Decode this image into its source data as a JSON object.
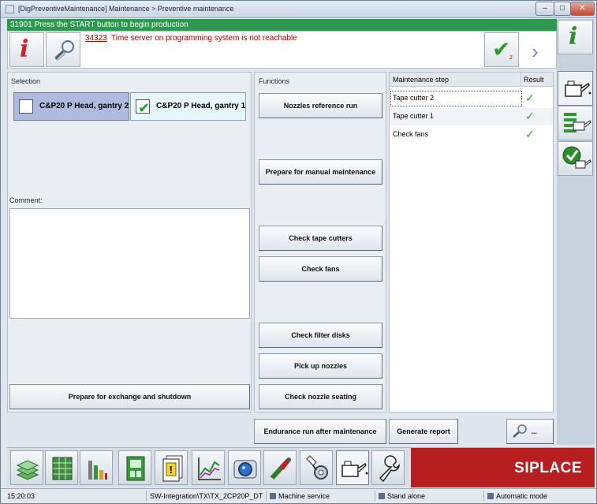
{
  "window": {
    "title": "[DigPreventiveMaintenance] Maintenance > Preventive maintenance",
    "controls": {
      "minimize": "–",
      "maximize": "□",
      "close": "✕"
    }
  },
  "banner": {
    "text": "31901 Press the START button to begin production",
    "color": "#2f9a4f"
  },
  "messages": {
    "number": "34323",
    "text": "Time server on programming system is not reachable",
    "ok_count": "2"
  },
  "selection": {
    "label": "Selection",
    "gantries": [
      {
        "label": "C&P20 P Head, gantry 2",
        "checked": false
      },
      {
        "label": "C&P20 P Head, gantry 1",
        "checked": true
      }
    ],
    "comment_label": "Comment:",
    "comment_value": ""
  },
  "functions": {
    "label": "Functions",
    "buttons": [
      "Nozzles reference run",
      "Prepare for manual maintenance",
      "Check tape cutters",
      "Check fans",
      "Check filter disks",
      "Pick up nozzles",
      "Check nozzle seating"
    ]
  },
  "steps": {
    "col_step": "Maintenance step",
    "col_result": "Result",
    "rows": [
      {
        "name": "Tape cutter 2",
        "result": "✓"
      },
      {
        "name": "Tape cutter 1",
        "result": "✓"
      },
      {
        "name": "Check fans",
        "result": "✓"
      }
    ]
  },
  "bottom_buttons": {
    "exchange": "Prepare for exchange and shutdown",
    "endurance": "Endurance run after maintenance",
    "report": "Generate report",
    "search_more": "..."
  },
  "brand": {
    "name": "SIPLACE",
    "color": "#b71e20"
  },
  "status": {
    "time": "15:20:03",
    "path": "SW-Integration\\TX\\TX_2CP20P_DT",
    "machine": "Machine service",
    "mode1": "Stand alone",
    "mode2": "Automatic mode"
  },
  "icons": {
    "taskbar": [
      "stack-icon",
      "grid-icon",
      "bar-icon",
      "board-icon",
      "document-icon",
      "chart-icon",
      "camera-icon",
      "nozzle-icon",
      "gear-hand-icon",
      "oilcan-icon",
      "wrench-icon"
    ],
    "side": [
      "info-icon",
      "oilcan-icon",
      "list-oilcan-icon",
      "check-oilcan-icon"
    ]
  }
}
